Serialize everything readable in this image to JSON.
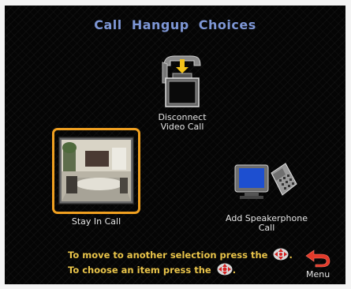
{
  "screen": {
    "title": "Call Hangup Choices",
    "options": [
      {
        "line1": "Disconnect",
        "line2": "Video Call",
        "icon": "hangup-phone-monitor-icon",
        "selected": false
      },
      {
        "line1": "Stay In Call",
        "line2": "",
        "icon": "video-room-thumbnail",
        "selected": true
      },
      {
        "line1": "Add Speakerphone",
        "line2": "Call",
        "icon": "tv-and-phone-icon",
        "selected": false
      }
    ],
    "hints": {
      "move_text": "To move to another selection press the",
      "choose_text": "To choose an item press the",
      "dot": "."
    },
    "menu_label": "Menu",
    "colors": {
      "accent": "#f0a020",
      "title": "#7e97d6",
      "hint": "#e9c44a",
      "menu_arrow": "#e23a2a"
    }
  }
}
